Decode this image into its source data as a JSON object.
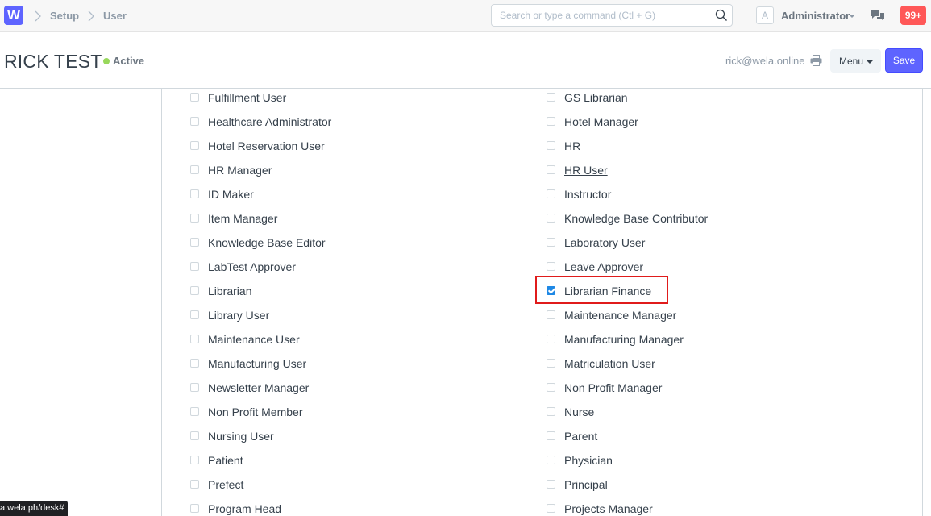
{
  "navbar": {
    "logo": "W",
    "breadcrumbs": [
      "Setup",
      "User"
    ],
    "search_placeholder": "Search or type a command (Ctl + G)",
    "avatar_letter": "A",
    "user_name": "Administrator",
    "notifications": "99+"
  },
  "page": {
    "title": "RICK TEST",
    "status": "Active",
    "email": "rick@wela.online",
    "menu_label": "Menu",
    "save_label": "Save"
  },
  "roles": {
    "left": [
      {
        "label": "Fulfillment User",
        "checked": false
      },
      {
        "label": "Healthcare Administrator",
        "checked": false
      },
      {
        "label": "Hotel Reservation User",
        "checked": false
      },
      {
        "label": "HR Manager",
        "checked": false
      },
      {
        "label": "ID Maker",
        "checked": false
      },
      {
        "label": "Item Manager",
        "checked": false
      },
      {
        "label": "Knowledge Base Editor",
        "checked": false
      },
      {
        "label": "LabTest Approver",
        "checked": false
      },
      {
        "label": "Librarian",
        "checked": false
      },
      {
        "label": "Library User",
        "checked": false
      },
      {
        "label": "Maintenance User",
        "checked": false
      },
      {
        "label": "Manufacturing User",
        "checked": false
      },
      {
        "label": "Newsletter Manager",
        "checked": false
      },
      {
        "label": "Non Profit Member",
        "checked": false
      },
      {
        "label": "Nursing User",
        "checked": false
      },
      {
        "label": "Patient",
        "checked": false
      },
      {
        "label": "Prefect",
        "checked": false
      },
      {
        "label": "Program Head",
        "checked": false
      }
    ],
    "right": [
      {
        "label": "GS Librarian",
        "checked": false
      },
      {
        "label": "Hotel Manager",
        "checked": false
      },
      {
        "label": "HR",
        "checked": false
      },
      {
        "label": "HR User",
        "checked": false,
        "underline": true
      },
      {
        "label": "Instructor",
        "checked": false
      },
      {
        "label": "Knowledge Base Contributor",
        "checked": false
      },
      {
        "label": "Laboratory User",
        "checked": false
      },
      {
        "label": "Leave Approver",
        "checked": false
      },
      {
        "label": "Librarian Finance",
        "checked": true
      },
      {
        "label": "Maintenance Manager",
        "checked": false
      },
      {
        "label": "Manufacturing Manager",
        "checked": false
      },
      {
        "label": "Matriculation User",
        "checked": false
      },
      {
        "label": "Non Profit Manager",
        "checked": false
      },
      {
        "label": "Nurse",
        "checked": false
      },
      {
        "label": "Parent",
        "checked": false
      },
      {
        "label": "Physician",
        "checked": false
      },
      {
        "label": "Principal",
        "checked": false
      },
      {
        "label": "Projects Manager",
        "checked": false
      }
    ]
  },
  "statusbar": {
    "url": "a.wela.ph/desk#"
  },
  "colors": {
    "primary": "#5e64ff",
    "active_dot": "#98d85b",
    "badge": "#ff5858",
    "highlight": "#e01b1b"
  }
}
